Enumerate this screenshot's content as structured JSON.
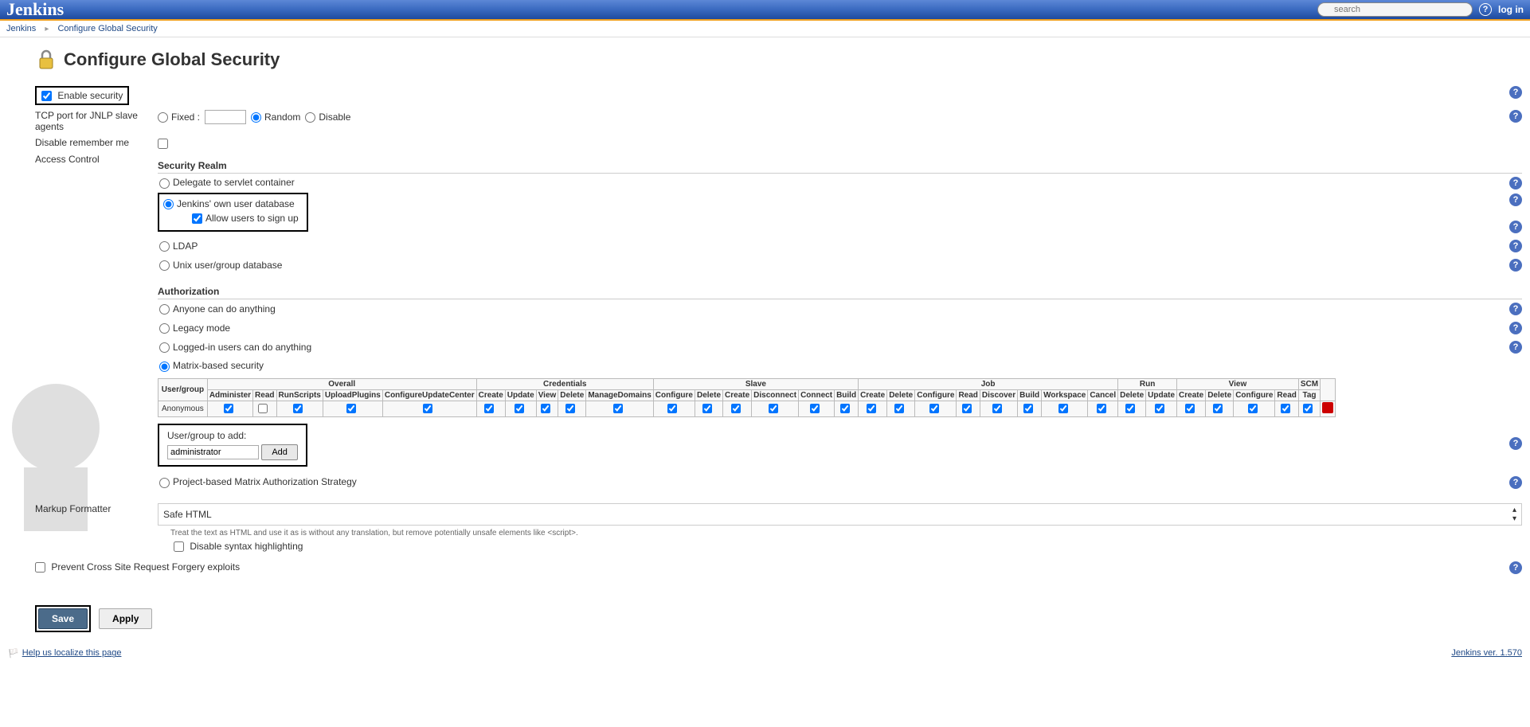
{
  "header": {
    "logo": "Jenkins",
    "search_placeholder": "search",
    "login": "log in"
  },
  "breadcrumbs": {
    "root": "Jenkins",
    "current": "Configure Global Security"
  },
  "title": "Configure Global Security",
  "labels": {
    "enable_security": "Enable security",
    "tcp_port": "TCP port for JNLP slave agents",
    "fixed": "Fixed :",
    "random": "Random",
    "disable": "Disable",
    "remember_me": "Disable remember me",
    "access_control": "Access Control",
    "security_realm": "Security Realm",
    "delegate": "Delegate to servlet container",
    "own_db": "Jenkins' own user database",
    "allow_signup": "Allow users to sign up",
    "ldap": "LDAP",
    "unix": "Unix user/group database",
    "authorization": "Authorization",
    "anyone": "Anyone can do anything",
    "legacy": "Legacy mode",
    "logged_in": "Logged-in users can do anything",
    "matrix": "Matrix-based security",
    "project_matrix": "Project-based Matrix Authorization Strategy",
    "user_group": "User/group",
    "anonymous": "Anonymous",
    "add_label": "User/group to add:",
    "add_value": "administrator",
    "add_btn": "Add",
    "markup": "Markup Formatter",
    "safe_html": "Safe HTML",
    "safe_html_desc": "Treat the text as HTML and use it as is without any translation, but remove potentially unsafe elements like <script>.",
    "disable_syntax": "Disable syntax highlighting",
    "csrf": "Prevent Cross Site Request Forgery exploits",
    "save": "Save",
    "apply": "Apply"
  },
  "matrix": {
    "groups": [
      {
        "name": "Overall",
        "cols": [
          "Administer",
          "Read",
          "RunScripts",
          "UploadPlugins",
          "ConfigureUpdateCenter"
        ]
      },
      {
        "name": "Credentials",
        "cols": [
          "Create",
          "Update",
          "View",
          "Delete",
          "ManageDomains"
        ]
      },
      {
        "name": "Slave",
        "cols": [
          "Configure",
          "Delete",
          "Create",
          "Disconnect",
          "Connect",
          "Build"
        ]
      },
      {
        "name": "Job",
        "cols": [
          "Create",
          "Delete",
          "Configure",
          "Read",
          "Discover",
          "Build",
          "Workspace",
          "Cancel"
        ]
      },
      {
        "name": "Run",
        "cols": [
          "Delete",
          "Update"
        ]
      },
      {
        "name": "View",
        "cols": [
          "Create",
          "Delete",
          "Configure",
          "Read"
        ]
      },
      {
        "name": "SCM",
        "cols": [
          "Tag"
        ]
      }
    ],
    "row": {
      "name": "Anonymous",
      "checks": [
        true,
        false,
        true,
        true,
        true,
        true,
        true,
        true,
        true,
        true,
        true,
        true,
        true,
        true,
        true,
        true,
        true,
        true,
        true,
        true,
        true,
        true,
        true,
        true,
        true,
        true,
        true,
        true,
        true,
        true,
        true
      ]
    }
  },
  "footer": {
    "localize": "Help us localize this page",
    "version": "Jenkins ver. 1.570"
  }
}
